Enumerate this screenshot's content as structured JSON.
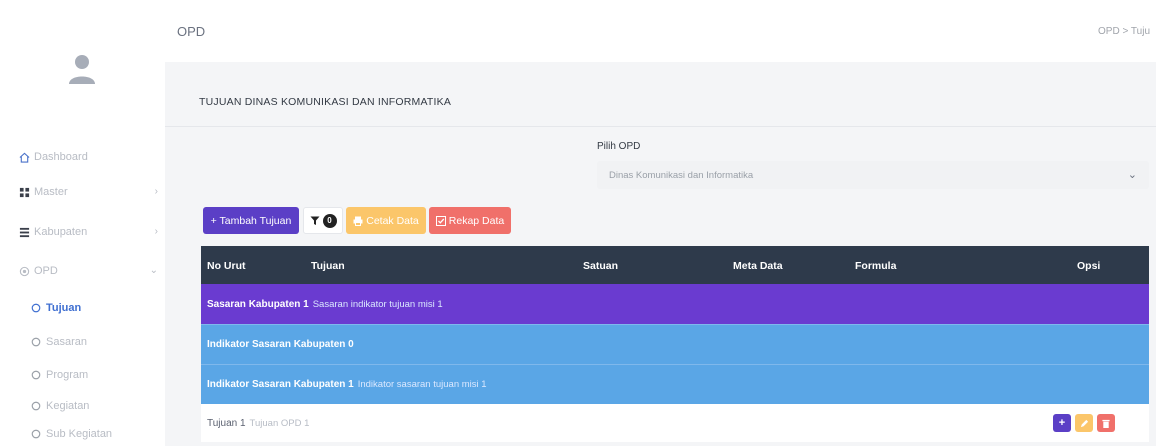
{
  "header": {
    "title": "OPD",
    "breadcrumb": "OPD > Tuju"
  },
  "sidebar": {
    "items": [
      {
        "label": "Dashboard",
        "icon": "home-icon"
      },
      {
        "label": "Master",
        "icon": "grid-icon"
      },
      {
        "label": "Kabupaten",
        "icon": "list-icon"
      },
      {
        "label": "OPD",
        "icon": "circle-icon"
      }
    ],
    "sub_items": [
      {
        "label": "Tujuan",
        "active": true
      },
      {
        "label": "Sasaran"
      },
      {
        "label": "Program"
      },
      {
        "label": "Kegiatan"
      },
      {
        "label": "Sub Kegiatan"
      }
    ],
    "chevron": "›",
    "chevron_open": "⌄"
  },
  "main": {
    "section_title": "TUJUAN DINAS KOMUNIKASI DAN INFORMATIKA",
    "opd_label": "Pilih OPD",
    "opd_selected": "Dinas Komunikasi dan Informatika",
    "buttons": {
      "tambah": "+ Tambah Tujuan",
      "filter_count": "0",
      "cetak": "Cetak Data",
      "rekap": "Rekap Data"
    },
    "table": {
      "headers": [
        "No Urut",
        "Tujuan",
        "Satuan",
        "Meta Data",
        "Formula",
        "Opsi"
      ],
      "rows": [
        {
          "bold": "Sasaran Kabupaten 1",
          "text": "Sasaran indikator tujuan misi 1"
        },
        {
          "bold": "Indikator Sasaran Kabupaten 0",
          "text": ""
        },
        {
          "bold": "Indikator Sasaran Kabupaten 1",
          "text": "Indikator sasaran tujuan misi 1"
        },
        {
          "bold": "Tujuan 1",
          "text": "Tujuan OPD 1"
        }
      ]
    }
  },
  "colors": {
    "purple": "#6a3bd0",
    "blue": "#5aa6e6",
    "header_dark": "#2e3a4b",
    "yellow": "#fbc66a",
    "red": "#f0706a"
  }
}
